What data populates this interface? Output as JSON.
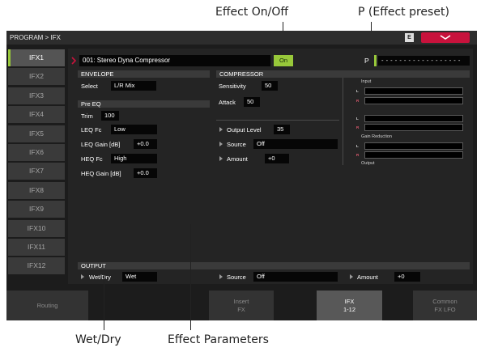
{
  "callouts": {
    "effect_onoff": "Effect On/Off",
    "effect_preset": "P (Effect preset)",
    "wet_dry": "Wet/Dry",
    "effect_parameters": "Effect Parameters"
  },
  "topbar": {
    "breadcrumb": "PROGRAM > IFX",
    "icon_label": "E"
  },
  "tabs": [
    "IFX1",
    "IFX2",
    "IFX3",
    "IFX4",
    "IFX5",
    "IFX6",
    "IFX7",
    "IFX8",
    "IFX9",
    "IFX10",
    "IFX11",
    "IFX12"
  ],
  "active_tab": "IFX1",
  "effect": {
    "name": "001: Stereo Dyna Compressor",
    "on_label": "On",
    "preset_label": "P",
    "preset_value": "- - - - - - - - - - - - - - - - - -"
  },
  "envelope": {
    "header": "ENVELOPE",
    "select_label": "Select",
    "select_value": "L/R Mix"
  },
  "pre_eq": {
    "header": "Pre EQ",
    "trim_label": "Trim",
    "trim_value": "100",
    "leq_fc_label": "LEQ Fc",
    "leq_fc_value": "Low",
    "leq_gain_label": "LEQ Gain [dB]",
    "leq_gain_value": "+0.0",
    "heq_fc_label": "HEQ Fc",
    "heq_fc_value": "High",
    "heq_gain_label": "HEQ Gain [dB]",
    "heq_gain_value": "+0.0"
  },
  "compressor": {
    "header": "COMPRESSOR",
    "sensitivity_label": "Sensitivity",
    "sensitivity_value": "50",
    "attack_label": "Attack",
    "attack_value": "50",
    "output_level_label": "Output Level",
    "output_level_value": "35",
    "source_label": "Source",
    "source_value": "Off",
    "amount_label": "Amount",
    "amount_value": "+0"
  },
  "meters": {
    "input_label": "Input",
    "gain_reduction_label": "Gain Reduction",
    "output_label": "Output",
    "l": "L",
    "r": "R"
  },
  "output": {
    "header": "OUTPUT",
    "wetdry_label": "Wet/Dry",
    "wetdry_value": "Wet",
    "source_label": "Source",
    "source_value": "Off",
    "amount_label": "Amount",
    "amount_value": "+0"
  },
  "bottom_buttons": [
    {
      "line1": "Routing",
      "line2": ""
    },
    {
      "line1": "Insert",
      "line2": "FX"
    },
    {
      "line1": "IFX",
      "line2": "1-12"
    },
    {
      "line1": "Common",
      "line2": "FX LFO"
    }
  ],
  "colors": {
    "accent_green": "#98c83a",
    "accent_red": "#c8123c",
    "background": "#1c1c1c"
  }
}
